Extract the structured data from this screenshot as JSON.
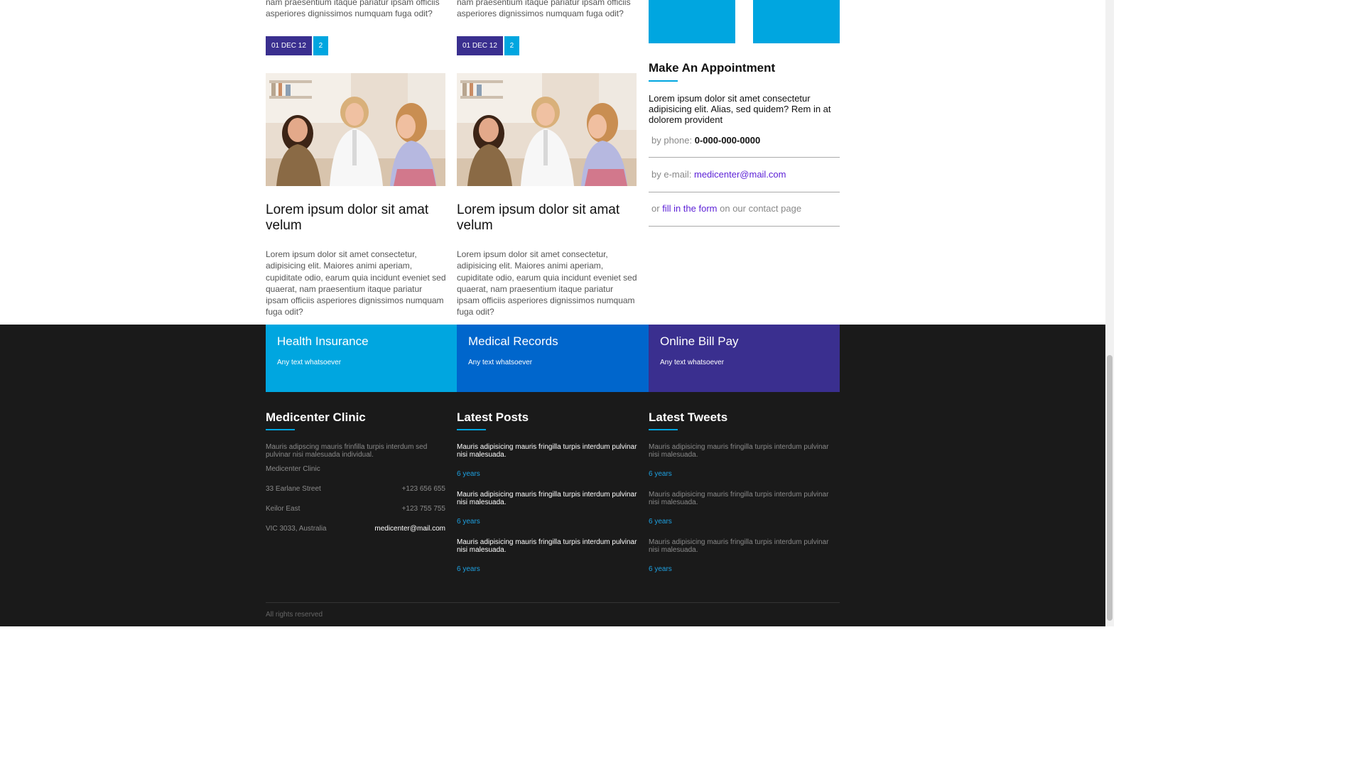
{
  "posts": {
    "top_excerpt_line1": "nam praesentium itaque pariatur ipsam officiis",
    "top_excerpt_line2": "asperiores dignissimos numquam fuga odit?",
    "date": "01 DEC 12",
    "comments": "2",
    "title": "Lorem ipsum dolor sit amat velum",
    "excerpt": "Lorem ipsum dolor sit amet consectetur, adipisicing elit. Maiores animi aperiam, cupiditate odio, earum quia incidunt eveniet sed quaerat, nam praesentium itaque pariatur ipsam officiis asperiores dignissimos numquam fuga odit?"
  },
  "sidebar": {
    "appointment_heading": "Make An Appointment",
    "appointment_text": "Lorem ipsum dolor sit amet consectetur adipisicing elit. Alias, sed quidem? Rem in at dolorem provident",
    "phone_label": "by phone:",
    "phone": "0-000-000-0000",
    "email_label": "by e-mail:",
    "email": "medicenter@mail.com",
    "form_prefix": "or",
    "form_link": "fill in the form",
    "form_suffix": "on our contact page"
  },
  "features": [
    {
      "title": "Health Insurance",
      "text": "Any text whatsoever",
      "color": "#00a6e0"
    },
    {
      "title": "Medical Records",
      "text": "Any text whatsoever",
      "color": "#0066cc"
    },
    {
      "title": "Online Bill Pay",
      "text": "Any text whatsoever",
      "color": "#3a2f8f"
    }
  ],
  "footer": {
    "clinic": {
      "heading": "Medicenter Clinic",
      "intro": "Mauris adipscing mauris frinfilla turpis interdum sed pulvinar nisi malesuada individual.",
      "name": "Medicenter Clinic",
      "street": "33 Earlane Street",
      "phone1": "+123 656 655",
      "suburb": "Keilor East",
      "phone2": "+123 755 755",
      "region": "VIC 3033, Australia",
      "email": "medicenter@mail.com"
    },
    "latest_posts": {
      "heading": "Latest Posts",
      "items": [
        {
          "text": "Mauris adipisicing mauris fringilla turpis interdum pulvinar nisi malesuada.",
          "age": "6 years"
        },
        {
          "text": "Mauris adipisicing mauris fringilla turpis interdum pulvinar nisi malesuada.",
          "age": "6 years"
        },
        {
          "text": "Mauris adipisicing mauris fringilla turpis interdum pulvinar nisi malesuada.",
          "age": "6 years"
        }
      ]
    },
    "latest_tweets": {
      "heading": "Latest Tweets",
      "items": [
        {
          "text": "Mauris adipisicing mauris fringilla turpis interdum pulvinar nisi malesuada.",
          "age": "6 years"
        },
        {
          "text": "Mauris adipisicing mauris fringilla turpis interdum pulvinar nisi malesuada.",
          "age": "6 years"
        },
        {
          "text": "Mauris adipisicing mauris fringilla turpis interdum pulvinar nisi malesuada.",
          "age": "6 years"
        }
      ]
    },
    "copyright": "All rights reserved"
  },
  "colors": {
    "accent": "#00a6e0",
    "date_badge": "#3a2f8f",
    "footer_bg": "#1a1a1a",
    "link": "#5b1fd6"
  }
}
